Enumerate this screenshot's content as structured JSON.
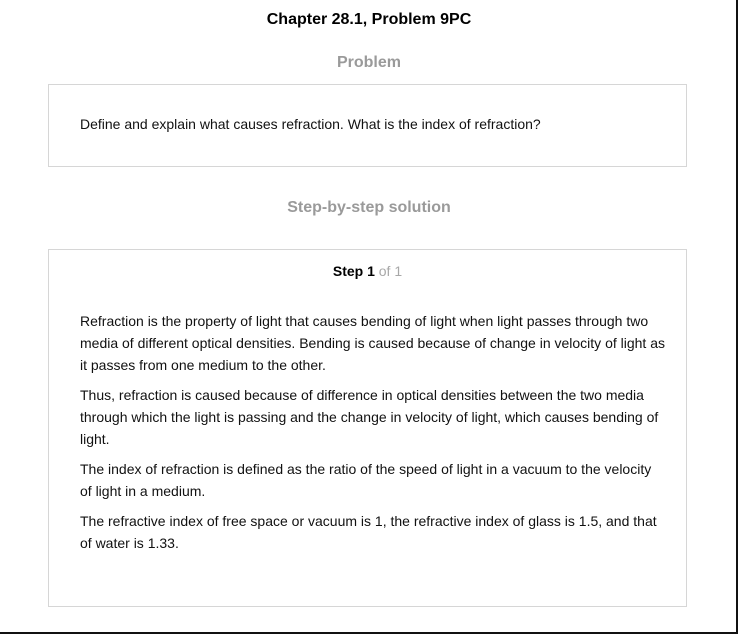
{
  "header": {
    "title": "Chapter 28.1, Problem 9PC"
  },
  "problem": {
    "heading": "Problem",
    "text": "Define and explain what causes refraction. What is the index of refraction?"
  },
  "solution": {
    "heading": "Step-by-step solution",
    "step_label": "Step 1",
    "step_count": "of 1",
    "paragraphs": [
      "Refraction is the property of light that causes bending of light when light passes through two media of different optical densities. Bending is caused because of change in velocity of light as it passes from one medium to the other.",
      "Thus, refraction is caused because of difference in optical densities between the two media through which the light is passing and the change in velocity of light, which causes bending of light.",
      "The index of refraction is defined as the ratio of the speed of light in a vacuum to the velocity of light in a medium.",
      "The refractive index of free space or vacuum is 1, the refractive index of glass is 1.5, and that of water is 1.33."
    ]
  },
  "colors": {
    "heading_gray": "#9a9a9a",
    "step_count_gray": "#a8a8a8",
    "border": "#d6d6d6",
    "text": "#111111"
  }
}
